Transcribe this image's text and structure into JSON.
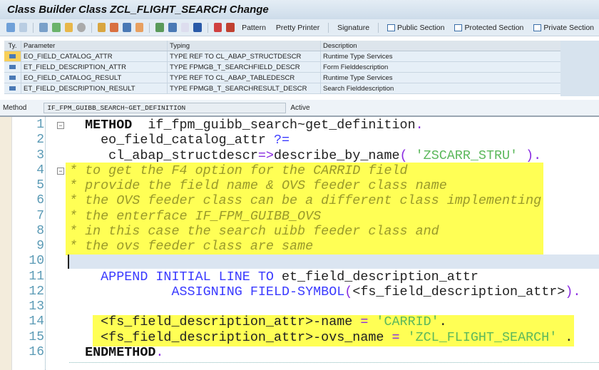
{
  "window": {
    "title": "Class Builder Class ZCL_FLIGHT_SEARCH Change"
  },
  "toolbar": {
    "buttons": [
      "Pattern",
      "Pretty Printer",
      "Signature",
      "Public Section",
      "Protected Section",
      "Private Section"
    ]
  },
  "parameters": {
    "headers": [
      "Ty.",
      "Parameter",
      "Typing",
      "Description"
    ],
    "rows": [
      {
        "name": "EO_FIELD_CATALOG_ATTR",
        "typing": "TYPE REF TO CL_ABAP_STRUCTDESCR",
        "description": "Runtime Type Services"
      },
      {
        "name": "ET_FIELD_DESCRIPTION_ATTR",
        "typing": "TYPE FPMGB_T_SEARCHFIELD_DESCR",
        "description": "Form Fielddescription"
      },
      {
        "name": "EO_FIELD_CATALOG_RESULT",
        "typing": "TYPE REF TO CL_ABAP_TABLEDESCR",
        "description": "Runtime Type Services"
      },
      {
        "name": "ET_FIELD_DESCRIPTION_RESULT",
        "typing": "TYPE FPMGB_T_SEARCHRESULT_DESCR",
        "description": "Search Fielddescription"
      }
    ]
  },
  "method": {
    "label": "Method",
    "value": "IF_FPM_GUIBB_SEARCH~GET_DEFINITION",
    "status": "Active"
  },
  "editor": {
    "line_numbers": [
      "1",
      "2",
      "3",
      "4",
      "5",
      "6",
      "7",
      "8",
      "9",
      "10",
      "11",
      "12",
      "13",
      "14",
      "15",
      "16"
    ],
    "lines": [
      [
        [
          "kw",
          "  METHOD"
        ],
        [
          "",
          "  if_fpm_guibb_search~get_definition"
        ],
        [
          "op",
          "."
        ]
      ],
      [
        [
          "",
          "    eo_field_catalog_attr "
        ],
        [
          "kb",
          "?="
        ]
      ],
      [
        [
          "",
          "     cl_abap_structdescr"
        ],
        [
          "op",
          "=>"
        ],
        [
          "",
          "describe_by_name"
        ],
        [
          "op",
          "( "
        ],
        [
          "st",
          "'ZSCARR_STRU'"
        ],
        [
          "op",
          " )."
        ]
      ],
      [
        [
          "cm",
          "* to get the F4 option for the CARRID field"
        ]
      ],
      [
        [
          "cm",
          "* provide the field name & OVS feeder class name"
        ]
      ],
      [
        [
          "cm",
          "* the OVS feeder class can be a different class implementing"
        ]
      ],
      [
        [
          "cm",
          "* the enterface IF_FPM_GUIBB_OVS"
        ]
      ],
      [
        [
          "cm",
          "* in this case the search uibb feeder class and"
        ]
      ],
      [
        [
          "cm",
          "* the ovs feeder class are same"
        ]
      ],
      [],
      [
        [
          "kb",
          "    APPEND INITIAL LINE TO"
        ],
        [
          "",
          " et_field_description_attr"
        ]
      ],
      [
        [
          "kb",
          "             ASSIGNING FIELD-SYMBOL"
        ],
        [
          "op",
          "("
        ],
        [
          "",
          "<fs_field_description_attr>"
        ],
        [
          "op",
          ")."
        ]
      ],
      [],
      [
        [
          "",
          "    <fs_field_description_attr>-name "
        ],
        [
          "op",
          "="
        ],
        [
          "st",
          " 'CARRID'"
        ],
        [
          "",
          "."
        ]
      ],
      [
        [
          "",
          "    <fs_field_description_attr>-ovs_name "
        ],
        [
          "op",
          "="
        ],
        [
          "st",
          " 'ZCL_FLIGHT_SEARCH'"
        ],
        [
          "",
          " ."
        ]
      ],
      [
        [
          "kw",
          "  ENDMETHOD"
        ],
        [
          "op",
          "."
        ]
      ]
    ]
  },
  "colors": {
    "highlight": "#ffff55",
    "keyword_blue": "#3a3aff",
    "string": "#5cb85c",
    "comment": "#9a9a2a"
  }
}
